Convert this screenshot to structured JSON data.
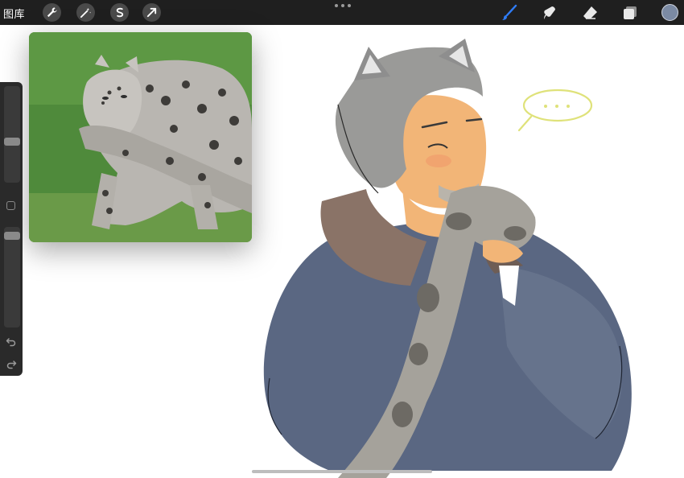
{
  "toolbar": {
    "gallery_label": "图库",
    "left_tools": [
      "wrench-icon",
      "magic-wand-icon",
      "selection-icon",
      "transform-arrow-icon"
    ],
    "right_tools": [
      "brush-icon",
      "smudge-icon",
      "eraser-icon",
      "layers-icon"
    ],
    "active_tool": "brush-icon",
    "current_color": "#7b8aa3",
    "accent_color": "#2f7cf6"
  },
  "sidebar": {
    "brush_size_level": 0.42,
    "opacity_level": 0.05,
    "buttons": [
      "modify-button",
      "undo-icon",
      "redo-icon"
    ]
  },
  "reference_window": {
    "subject": "snow-leopard-photo"
  },
  "artwork": {
    "speech_bubble_color": "#dfe27a"
  }
}
